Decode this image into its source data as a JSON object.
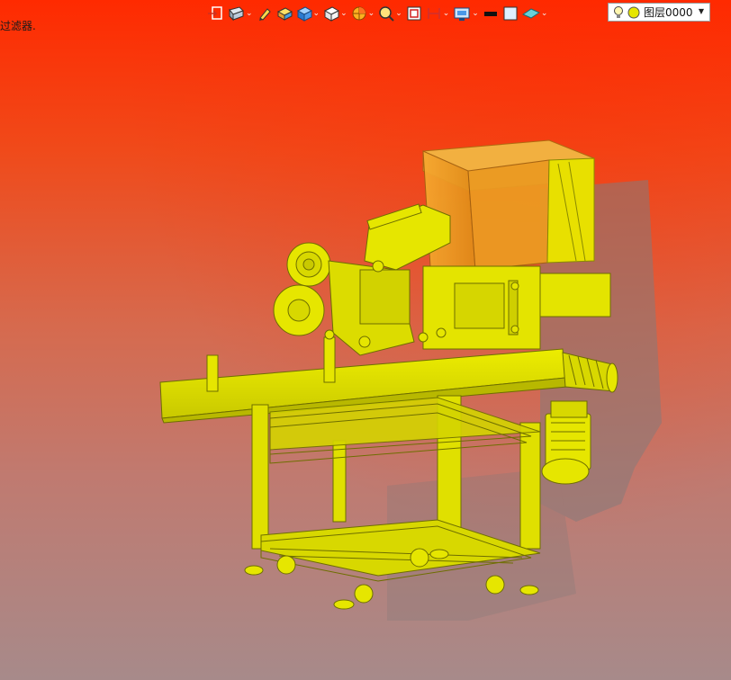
{
  "status": {
    "text": "过滤器."
  },
  "toolbar": {
    "buttons": [
      {
        "name": "exit-sketch-icon",
        "has_menu": false
      },
      {
        "name": "view-orientation-icon",
        "has_menu": true
      },
      {
        "name": "pencil-icon",
        "has_menu": false
      },
      {
        "name": "shaded-edges-icon",
        "has_menu": false
      },
      {
        "name": "display-style-icon",
        "has_menu": true
      },
      {
        "name": "cube-view-icon",
        "has_menu": true
      },
      {
        "name": "section-view-icon",
        "has_menu": true
      },
      {
        "name": "zoom-icon",
        "has_menu": true
      },
      {
        "name": "zoom-fit-icon",
        "has_menu": false
      },
      {
        "name": "measure-icon",
        "has_menu": true
      },
      {
        "name": "render-settings-icon",
        "has_menu": true
      },
      {
        "name": "line-color-icon",
        "has_menu": false
      },
      {
        "name": "fill-color-icon",
        "has_menu": false
      },
      {
        "name": "plane-icon",
        "has_menu": true
      }
    ],
    "chevron": "⌄"
  },
  "layer": {
    "name": "图层0000",
    "arrow": "▼"
  },
  "colors": {
    "background_top": "#ff2a00",
    "background_bottom": "#a78a8a",
    "model_yellow": "#e6e600",
    "hopper_orange": "#f0a020",
    "shadow": "#8a7a78"
  }
}
